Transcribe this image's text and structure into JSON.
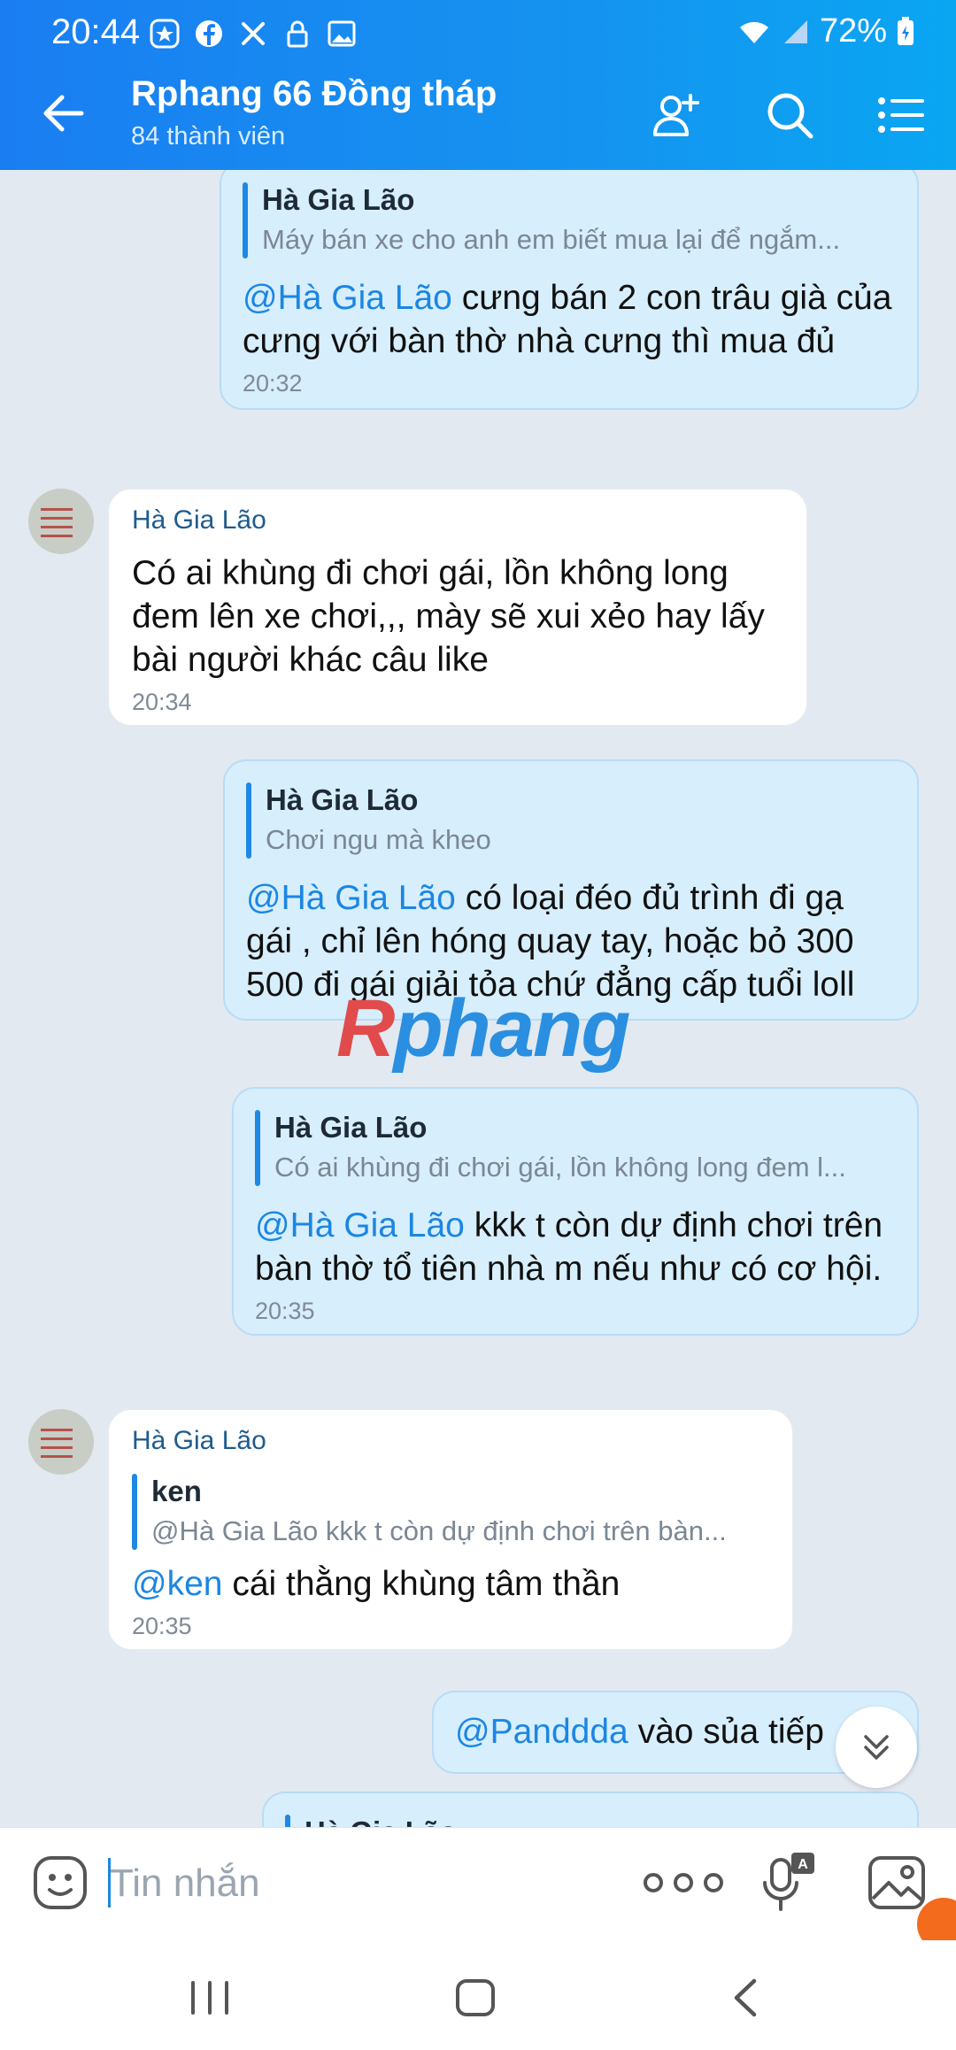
{
  "status": {
    "time": "20:44",
    "battery": "72%"
  },
  "header": {
    "title": "Rphang 66 Đồng tháp",
    "subtitle": "84 thành viên"
  },
  "messages": {
    "m1": {
      "quote_name": "Hà Gia Lão",
      "quote_text": "Máy bán xe cho anh em biết mua lại để ngắm...",
      "mention": "@Hà Gia Lão",
      "text": " cưng bán 2 con trâu già của cưng với bàn thờ nhà cưng thì mua đủ",
      "time": "20:32"
    },
    "m2": {
      "sender": "Hà Gia Lão",
      "text": "Có ai khùng đi chơi gái, lồn không long đem lên xe chơi,,, mày sẽ xui xẻo hay lấy bài người khác câu like",
      "time": "20:34"
    },
    "m3": {
      "quote_name": "Hà Gia Lão",
      "quote_text": "Chơi ngu mà kheo",
      "mention": "@Hà Gia Lão",
      "text": " có loại đéo đủ trình đi gạ gái , chỉ lên hóng quay tay, hoặc bỏ 300 500 đi gái giải tỏa chứ đẳng cấp tuổi loll"
    },
    "m4": {
      "quote_name": "Hà Gia Lão",
      "quote_text": "Có ai khùng đi chơi gái, lồn không long đem l...",
      "mention": "@Hà Gia Lão",
      "text": " kkk t còn dự định chơi trên bàn thờ tổ tiên nhà m nếu như có cơ hội.",
      "time": "20:35"
    },
    "m5": {
      "sender": "Hà Gia Lão",
      "quote_name": "ken",
      "quote_text": "@Hà Gia Lão kkk t còn dự định chơi trên bàn...",
      "mention": "@ken",
      "text": " cái thằng khùng tâm thần",
      "time": "20:35"
    },
    "m6": {
      "mention": "@Panddda",
      "text": "  vào sủa tiếp"
    },
    "m7": {
      "quote_name": "Hà Gia Lão"
    }
  },
  "watermark": {
    "first": "R",
    "rest": "phang"
  },
  "composer": {
    "placeholder": "Tin nhắn"
  },
  "colors": {
    "header": "#1a7ef2",
    "mention": "#1b86e3",
    "outgoing": "#d7eefc"
  }
}
